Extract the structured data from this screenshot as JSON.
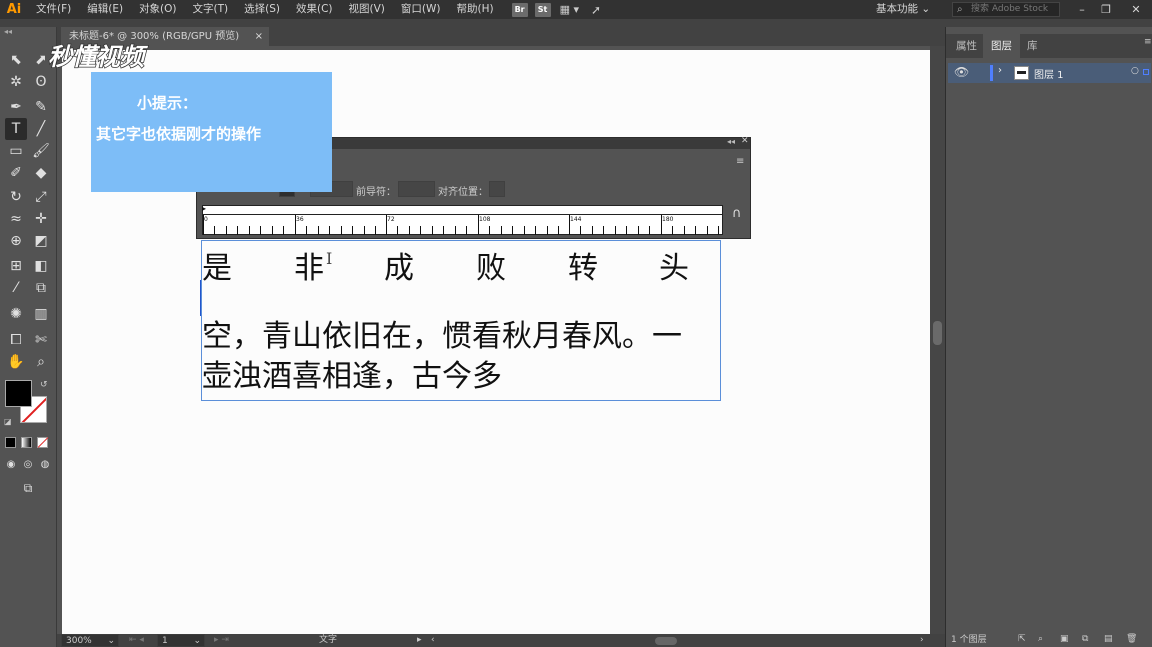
{
  "app": {
    "logo": "Ai"
  },
  "menus": [
    "文件(F)",
    "编辑(E)",
    "对象(O)",
    "文字(T)",
    "选择(S)",
    "效果(C)",
    "视图(V)",
    "窗口(W)",
    "帮助(H)"
  ],
  "app_badges": [
    "Br",
    "St"
  ],
  "workspace": {
    "label": "基本功能"
  },
  "stock_search": {
    "placeholder": "搜索 Adobe Stock"
  },
  "document_tab": {
    "title": "未标题-6* @ 300% (RGB/GPU 预览)",
    "close": "×"
  },
  "watermark": {
    "text": "秒懂视频"
  },
  "tip": {
    "title": "小提示：",
    "body": "其它字也依据刚才的操作"
  },
  "tabs_panel": {
    "leader_label": "前导符：",
    "align_label": "对齐位置：",
    "ruler_numbers": [
      "0",
      "36",
      "72",
      "108",
      "144",
      "180"
    ]
  },
  "text_frame": {
    "line1_chars": [
      "是",
      "非",
      "成",
      "败",
      "转",
      "头"
    ],
    "line2": "空，青山依旧在，惯看秋月春风。一",
    "line3": "壶浊酒喜相逢，古今多"
  },
  "right_panel": {
    "tabs": [
      "属性",
      "图层",
      "库"
    ],
    "active_tab": "图层",
    "layer": {
      "name": "图层 1"
    },
    "footer": "1 个图层"
  },
  "status_bar": {
    "zoom": "300%",
    "artboard": "1",
    "tool": "文字"
  },
  "icons": [
    "selection-icon",
    "type-tool-icon",
    "eye-icon",
    "search-icon",
    "hand-icon",
    "zoom-icon"
  ],
  "colors": {
    "accent": "#4f7fff",
    "tip_bg": "#7dbdf7",
    "logo": "#ff9a00"
  }
}
